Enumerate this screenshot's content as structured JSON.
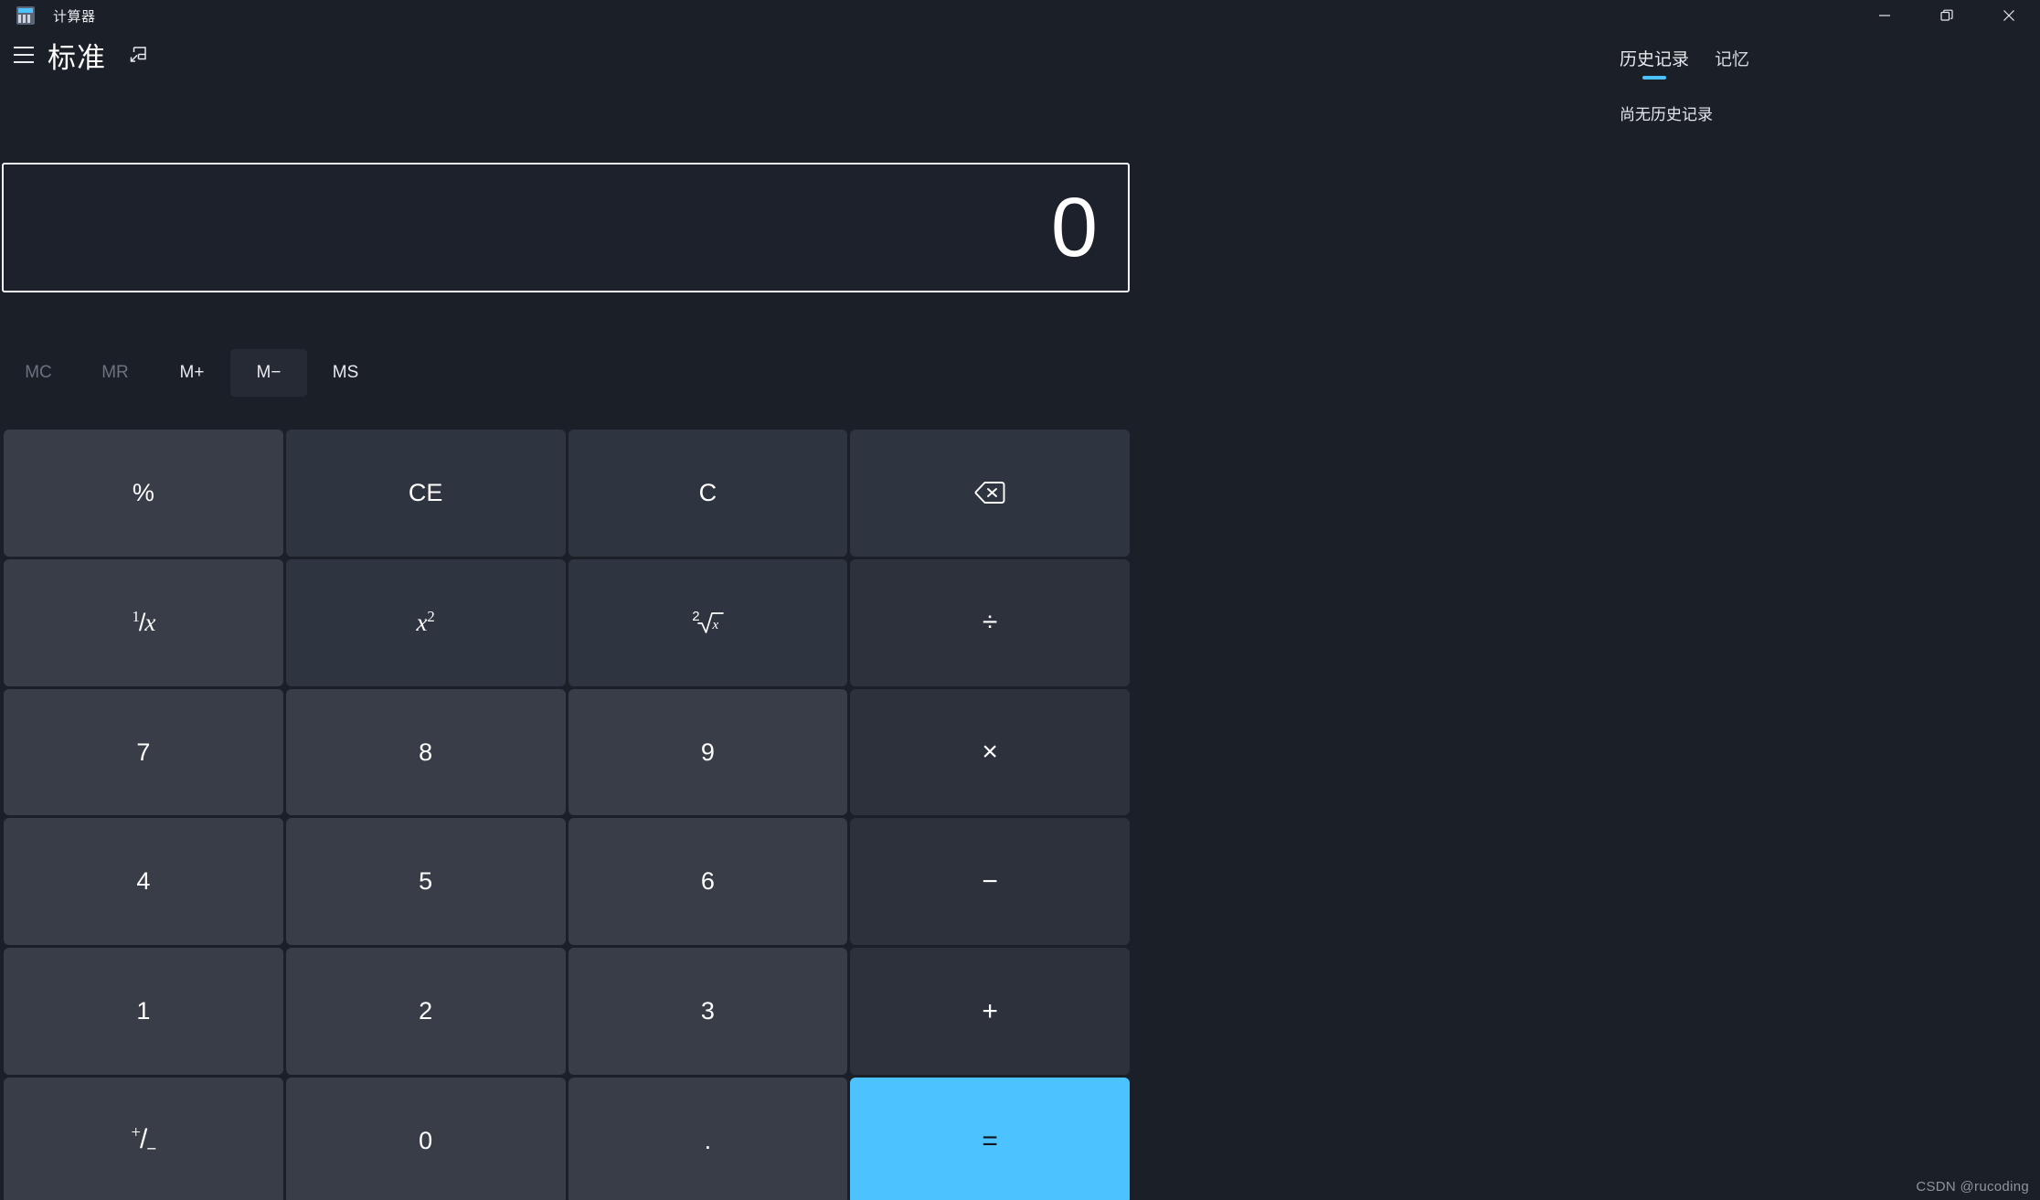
{
  "window": {
    "app_title": "计算器",
    "app_icon": "calculator-icon",
    "controls": {
      "minimize": "minimize-icon",
      "restore": "restore-icon",
      "close": "close-icon"
    }
  },
  "header": {
    "menu_icon": "hamburger-menu-icon",
    "mode_label": "标准",
    "keep_on_top_icon": "keep-on-top-icon"
  },
  "display": {
    "value": "0"
  },
  "memory": {
    "buttons": [
      {
        "label": "MC",
        "name": "memory-clear",
        "enabled": false
      },
      {
        "label": "MR",
        "name": "memory-recall",
        "enabled": false
      },
      {
        "label": "M+",
        "name": "memory-add",
        "enabled": true
      },
      {
        "label": "M−",
        "name": "memory-subtract",
        "enabled": true,
        "hover": true
      },
      {
        "label": "MS",
        "name": "memory-store",
        "enabled": true
      }
    ]
  },
  "keypad": {
    "row1": {
      "percent": "%",
      "clear_entry": "CE",
      "clear": "C",
      "backspace": "backspace-icon"
    },
    "row2": {
      "reciprocal_num": "1",
      "reciprocal_slash": "/",
      "reciprocal_x": "x",
      "square_x": "x",
      "square_exp": "2",
      "sqrt_index": "2",
      "sqrt_x": "x",
      "divide": "÷"
    },
    "row3": {
      "seven": "7",
      "eight": "8",
      "nine": "9",
      "multiply": "×"
    },
    "row4": {
      "four": "4",
      "five": "5",
      "six": "6",
      "subtract": "−"
    },
    "row5": {
      "one": "1",
      "two": "2",
      "three": "3",
      "add": "+"
    },
    "row6": {
      "sign_plus": "+",
      "sign_slash": "/",
      "sign_minus": "−",
      "zero": "0",
      "decimal": ".",
      "equals": "="
    }
  },
  "sidepanel": {
    "tabs": [
      {
        "label": "历史记录",
        "name": "tab-history",
        "active": true
      },
      {
        "label": "记忆",
        "name": "tab-memory",
        "active": false
      }
    ],
    "empty_message": "尚无历史记录"
  },
  "watermark": {
    "text": "CSDN @rucoding"
  },
  "colors": {
    "window_bg": "#1b1f27",
    "accent": "#4cc2ff",
    "number_key": "#383d47",
    "function_key": "#2f3540",
    "operator_key": "#2c313c",
    "display_border": "#f2f4f7"
  }
}
